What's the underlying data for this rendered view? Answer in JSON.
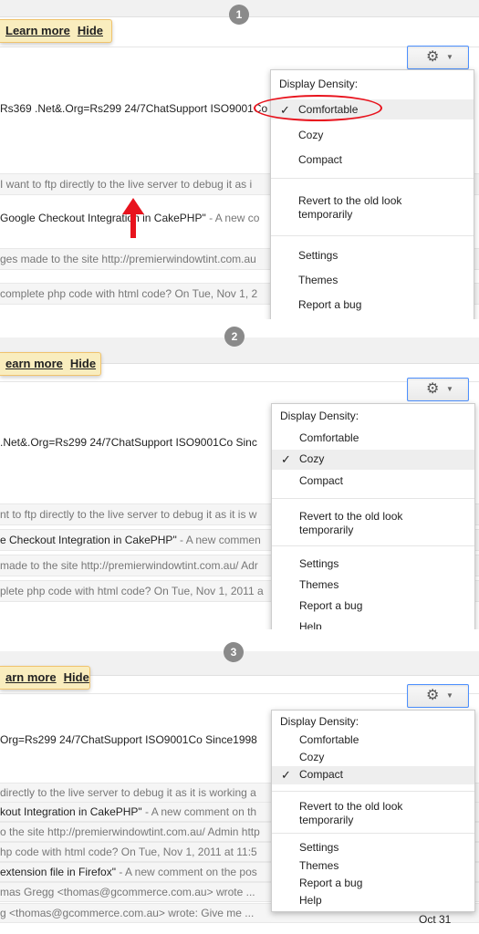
{
  "panels": [
    {
      "step": "1",
      "notice": {
        "learn_more": "Learn more",
        "hide": "Hide"
      },
      "rows": [
        {
          "text": "Rs369 .Net&.Org=Rs299 24/7ChatSupport ISO9001Co",
          "snippet": ""
        },
        {
          "text": "I want to ftp directly to the live server to debug it as i",
          "snippet": ""
        },
        {
          "text": "Google Checkout Integration in CakePHP\"",
          "snippet": " - A new co"
        },
        {
          "text": "ges made to the site http://premierwindowtint.com.au",
          "snippet": ""
        },
        {
          "text": " complete php code with html code? On Tue, Nov 1, 2",
          "snippet": ""
        }
      ],
      "menu": {
        "header": "Display Density:",
        "items": [
          "Comfortable",
          "Cozy",
          "Compact"
        ],
        "selected": "Comfortable",
        "revert": "Revert to the old look temporarily",
        "more": [
          "Settings",
          "Themes",
          "Report a bug"
        ]
      }
    },
    {
      "step": "2",
      "notice": {
        "learn_more": "earn more",
        "hide": "Hide"
      },
      "rows": [
        {
          "text": " .Net&.Org=Rs299 24/7ChatSupport ISO9001Co Sinc",
          "snippet": ""
        },
        {
          "text": "nt to ftp directly to the live server to debug it as it is w",
          "snippet": ""
        },
        {
          "text": "e Checkout Integration in CakePHP\"",
          "snippet": " - A new commen"
        },
        {
          "text": "made to the site http://premierwindowtint.com.au/ Adr",
          "snippet": ""
        },
        {
          "text": "plete php code with html code? On Tue, Nov 1, 2011 a",
          "snippet": ""
        }
      ],
      "menu": {
        "header": "Display Density:",
        "items": [
          "Comfortable",
          "Cozy",
          "Compact"
        ],
        "selected": "Cozy",
        "revert": "Revert to the old look temporarily",
        "more": [
          "Settings",
          "Themes",
          "Report a bug",
          "Help"
        ]
      }
    },
    {
      "step": "3",
      "notice": {
        "learn_more": "arn more",
        "hide": "Hide"
      },
      "rows": [
        {
          "text": "Org=Rs299 24/7ChatSupport ISO9001Co Since1998",
          "snippet": ""
        },
        {
          "text": " directly to the live server to debug it as it is working a",
          "snippet": ""
        },
        {
          "text": "kout Integration in CakePHP\"",
          "snippet": " - A new comment on th"
        },
        {
          "text": "o the site http://premierwindowtint.com.au/ Admin http",
          "snippet": ""
        },
        {
          "text": "hp code with html code? On Tue, Nov 1, 2011 at 11:5",
          "snippet": ""
        },
        {
          "text": "extension file in Firefox\"",
          "snippet": " - A new comment on the pos"
        },
        {
          "text": "mas Gregg <thomas@gcommerce.com.au> wrote ...",
          "snippet": ""
        },
        {
          "text": "g <thomas@gcommerce.com.au> wrote: Give me ...",
          "snippet": ""
        }
      ],
      "date": "Oct 31",
      "menu": {
        "header": "Display Density:",
        "items": [
          "Comfortable",
          "Cozy",
          "Compact"
        ],
        "selected": "Compact",
        "revert": "Revert to the old look temporarily",
        "more": [
          "Settings",
          "Themes",
          "Report a bug",
          "Help"
        ]
      }
    }
  ],
  "icons": {
    "gear": "gear-icon",
    "caret": "caret-down-icon",
    "check": "checkmark-icon",
    "arrow": "red-arrow-up"
  },
  "colors": {
    "notice_bg": "#f9edbe",
    "selected_row": "#eeeeee",
    "highlight_oval": "#e8131d",
    "button_border": "#4d90fe"
  }
}
